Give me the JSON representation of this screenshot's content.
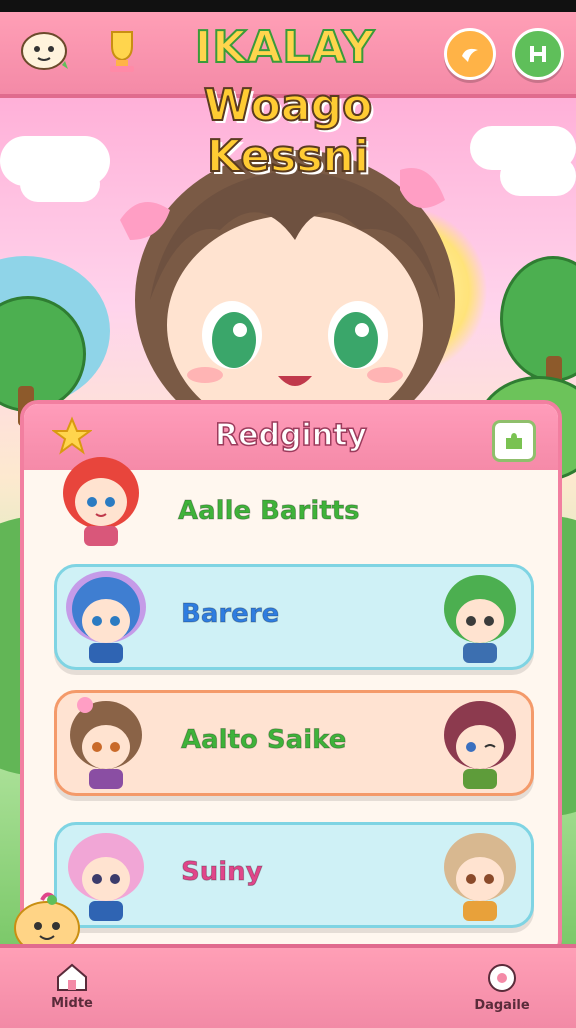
{
  "header": {
    "app_title": "IKALAY",
    "app_subtitle": "Woago Kessni",
    "left_icons": [
      "dog-mascot-icon",
      "trophy-icon"
    ],
    "right_buttons": [
      {
        "icon": "sun-swirl-icon",
        "color": "#ffb347"
      },
      {
        "icon": "h-letter-icon",
        "color": "#5fbf5a"
      }
    ]
  },
  "panel": {
    "title": "Redginty",
    "rows": [
      {
        "label": "Aalle Baritts",
        "label_color": "#3fb23a",
        "bg": "none",
        "avatar_left": "red-hair-girl",
        "avatar_right": ""
      },
      {
        "label": "Barere",
        "label_color": "#2f7de0",
        "bg": "#cff1f6",
        "avatar_left": "blue-hair-boy",
        "avatar_right": "green-hair-girl"
      },
      {
        "label": "Aalto Saike",
        "label_color": "#3fb23a",
        "bg": "#ffe3d2",
        "avatar_left": "brown-hair-girl",
        "avatar_right": "maroon-hair-girl"
      },
      {
        "label": "Suiny",
        "label_color": "#e0468a",
        "bg": "#cff1f6",
        "avatar_left": "pink-hair-girl",
        "avatar_right": "blonde-hair-girl"
      }
    ]
  },
  "bottom_nav": {
    "left": {
      "label": "Midte",
      "icon": "home-icon"
    },
    "right": {
      "label": "Dagaile",
      "icon": "gear-flower-icon"
    }
  },
  "colors": {
    "accent_pink": "#f48aa7",
    "panel_bg": "#fff7ef"
  }
}
